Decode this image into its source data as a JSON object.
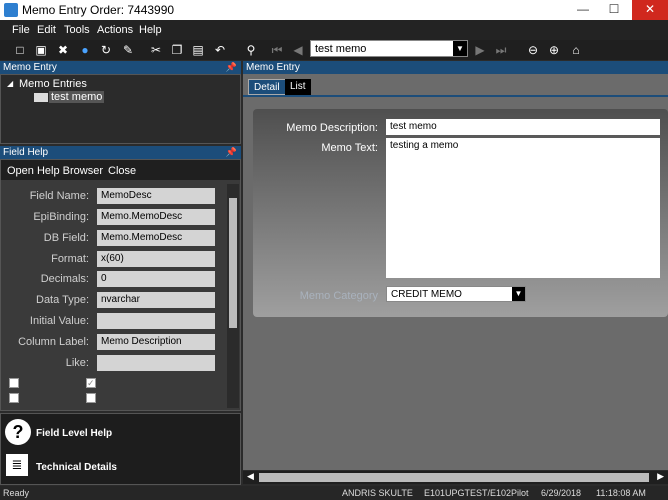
{
  "window": {
    "title": "Memo Entry Order: 7443990",
    "minimize": "—",
    "maximize": "☐",
    "close": "✕"
  },
  "menu": [
    "File",
    "Edit",
    "Tools",
    "Actions",
    "Help"
  ],
  "toolbar": {
    "memo_combo_value": "test memo"
  },
  "memo_panel": {
    "header": "Memo Entry",
    "tree_root": "Memo Entries",
    "tree_child": "test memo"
  },
  "field_help": {
    "header": "Field Help",
    "links": [
      "Open Help Browser",
      "Close"
    ],
    "rows": [
      {
        "label": "Field Name:",
        "value": "MemoDesc"
      },
      {
        "label": "EpiBinding:",
        "value": "Memo.MemoDesc"
      },
      {
        "label": "DB Field:",
        "value": "Memo.MemoDesc"
      },
      {
        "label": "Format:",
        "value": "x(60)"
      },
      {
        "label": "Decimals:",
        "value": "0"
      },
      {
        "label": "Data Type:",
        "value": "nvarchar"
      },
      {
        "label": "Initial Value:",
        "value": ""
      },
      {
        "label": "Column Label:",
        "value": "Memo Description"
      },
      {
        "label": "Like:",
        "value": ""
      }
    ]
  },
  "bottom_actions": [
    "Field Level Help",
    "Technical Details"
  ],
  "detail_panel": {
    "header": "Memo Entry",
    "tabs": [
      "Detail",
      "List"
    ],
    "memo_description_label": "Memo Description:",
    "memo_description": "test memo",
    "memo_text_label": "Memo Text:",
    "memo_text": "testing a memo",
    "memo_category_label": "Memo Category",
    "memo_category": "CREDIT MEMO"
  },
  "status": {
    "left": "Ready",
    "user": "ANDRIS SKULTE",
    "env": "E101UPGTEST/E102Pilot",
    "date": "6/29/2018",
    "time": "11:18:08 AM"
  }
}
